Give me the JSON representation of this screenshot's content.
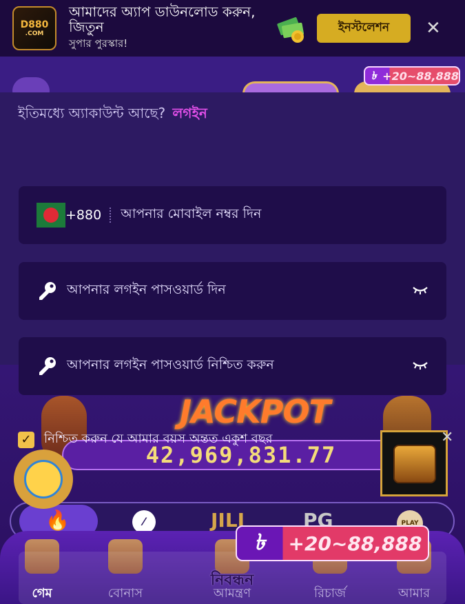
{
  "download_banner": {
    "logo_text": "D880",
    "logo_sub": ".COM",
    "title": "আমাদের অ্যাপ ডাউনলোড করুন, জিতুন",
    "subtitle": "সুপার পুরস্কার!",
    "install_label": "ইনস্টলেশন",
    "close_label": "✕"
  },
  "header": {
    "reward_currency": "৳",
    "reward_amount": "+20~88,888"
  },
  "modal": {
    "already_text": "ইতিমধ্যে অ্যাকাউন্ট আছে?",
    "login_link": "লগইন",
    "phone": {
      "country_code": "+880",
      "placeholder": "আপনার মোবাইল নম্বর দিন"
    },
    "password": {
      "placeholder": "আপনার লগইন পাসওয়ার্ড দিন"
    },
    "confirm_password": {
      "placeholder": "আপনার লগইন পাসওয়ার্ড নিশ্চিত করুন"
    },
    "age_check": {
      "checked": true,
      "label": "নিশ্চিত করুন যে আমার বয়স অন্তত একুশ বছর"
    }
  },
  "jackpot": {
    "title": "JACKPOT",
    "amount": "42,969,831.77"
  },
  "categories": {
    "slash_label": "⁄",
    "jili_label": "JILI",
    "pg_label": "PG",
    "play_label": "PLAY"
  },
  "promo": {
    "currency": "৳",
    "amount": "+20~88,888"
  },
  "bottom_nav": {
    "items": [
      {
        "label": "গেম"
      },
      {
        "label": "বোনাস"
      },
      {
        "label": "আমন্ত্রণ"
      },
      {
        "label": "রিচার্জ"
      },
      {
        "label": "আমার"
      }
    ],
    "register_label": "নিবন্ধন"
  },
  "colors": {
    "accent": "#e24fe9",
    "install_button": "#d6ac22",
    "modal_bg": "#2d1a62",
    "field_bg": "#1f0d4a"
  }
}
